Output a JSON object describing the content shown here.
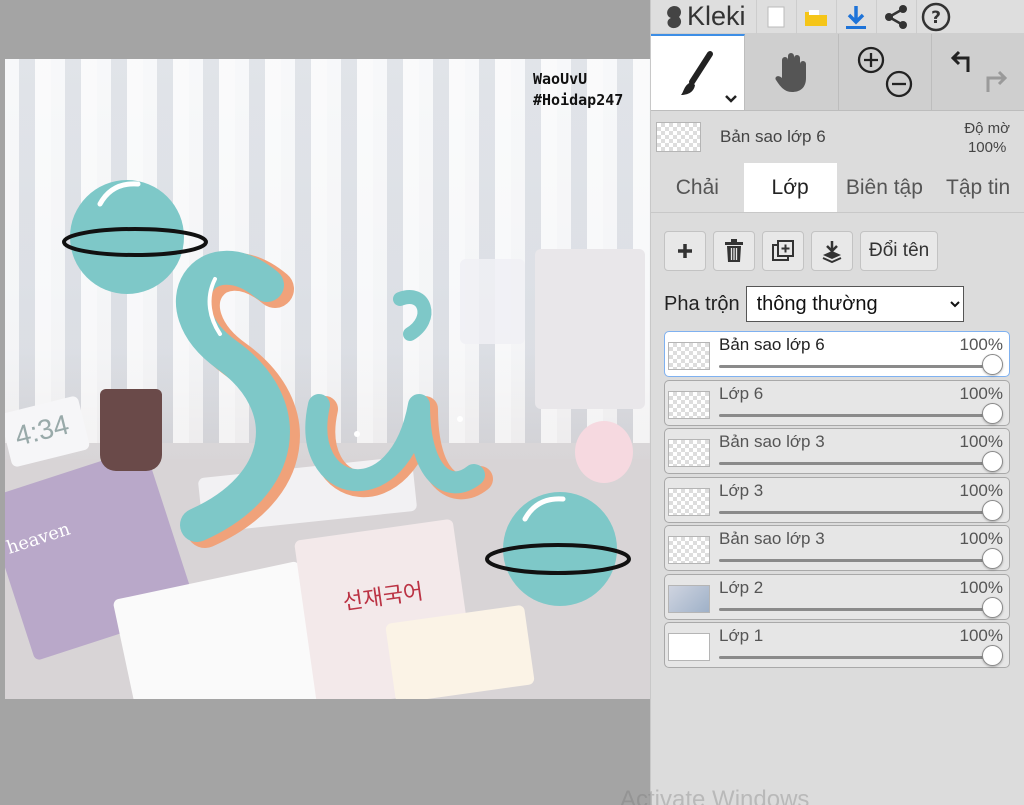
{
  "canvas": {
    "watermark_line1": "WaoUvU",
    "watermark_line2": "#Hoidap247",
    "notebook_title": "선재국어",
    "sticker_text": "heaven",
    "clock_text": "4:34"
  },
  "app": {
    "logo": "Kleki"
  },
  "colors": {
    "accent": "#3d8ee6",
    "planet": "#7ec8c8",
    "glyph_orange": "#f0a27a"
  },
  "layer_header": {
    "name": "Bản sao lớp 6",
    "opacity_label": "Độ mờ",
    "opacity_value": "100%"
  },
  "tabs": [
    {
      "label": "Chải"
    },
    {
      "label": "Lớp"
    },
    {
      "label": "Biên tập"
    },
    {
      "label": "Tập tin"
    }
  ],
  "actions": {
    "rename": "Đổi tên"
  },
  "blend": {
    "label": "Pha trộn",
    "value": "thông thường"
  },
  "layers": [
    {
      "name": "Bản sao lớp 6",
      "opacity": "100%",
      "opacity_value": 100,
      "selected": true
    },
    {
      "name": "Lớp 6",
      "opacity": "100%",
      "opacity_value": 100,
      "selected": false
    },
    {
      "name": "Bản sao lớp 3",
      "opacity": "100%",
      "opacity_value": 100,
      "selected": false
    },
    {
      "name": "Lớp 3",
      "opacity": "100%",
      "opacity_value": 100,
      "selected": false
    },
    {
      "name": "Bản sao lớp 3",
      "opacity": "100%",
      "opacity_value": 100,
      "selected": false
    },
    {
      "name": "Lớp 2",
      "opacity": "100%",
      "opacity_value": 100,
      "selected": false
    },
    {
      "name": "Lớp 1",
      "opacity": "100%",
      "opacity_value": 100,
      "selected": false
    }
  ],
  "overlay": {
    "activate_windows": "Activate Windows"
  }
}
